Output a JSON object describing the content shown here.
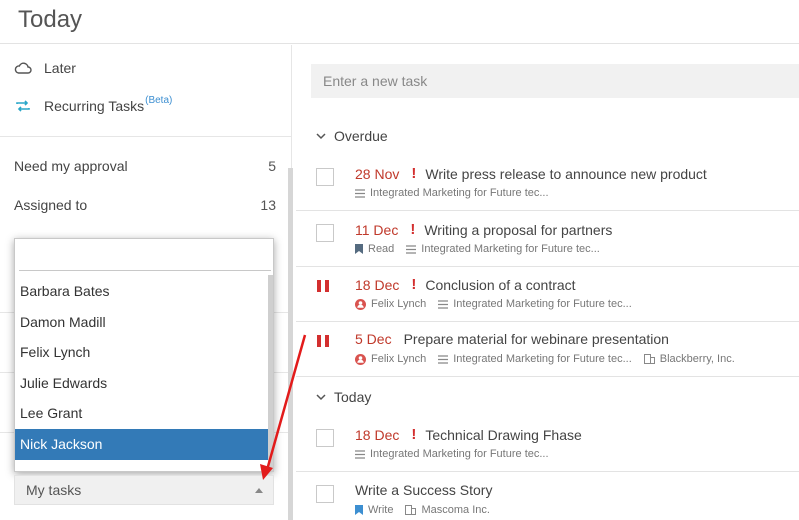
{
  "header": {
    "title": "Today"
  },
  "sidebar": {
    "later_label": "Later",
    "recurring_label": "Recurring Tasks",
    "recurring_badge": "(Beta)",
    "rows": [
      {
        "label": "Need my approval",
        "count": "5"
      },
      {
        "label": "Assigned to",
        "count": "13"
      }
    ],
    "dropdown": {
      "search_value": "",
      "options": [
        "Barbara Bates",
        "Damon Madill",
        "Felix Lynch",
        "Julie Edwards",
        "Lee Grant",
        "Nick Jackson"
      ],
      "selected": "Nick Jackson"
    },
    "filter_select": {
      "value": "My tasks"
    }
  },
  "main": {
    "new_task_placeholder": "Enter a new task",
    "sections": [
      {
        "label": "Overdue"
      },
      {
        "label": "Today"
      }
    ],
    "tasks": [
      {
        "date": "28 Nov",
        "important": true,
        "name": "Write press release to announce new product",
        "meta": [
          {
            "icon": "list-icon",
            "text": "Integrated Marketing for Future tec..."
          }
        ]
      },
      {
        "date": "11 Dec",
        "important": true,
        "name": "Writing a proposal for partners",
        "meta": [
          {
            "icon": "bookmark-icon",
            "text": "Read"
          },
          {
            "icon": "list-icon",
            "text": "Integrated Marketing for Future tec..."
          }
        ]
      },
      {
        "date": "18 Dec",
        "important": true,
        "name": "Conclusion of a contract",
        "meta": [
          {
            "icon": "user-icon",
            "text": "Felix Lynch"
          },
          {
            "icon": "list-icon",
            "text": "Integrated Marketing for Future tec..."
          }
        ]
      },
      {
        "date": "5 Dec",
        "important": false,
        "name": "Prepare material for webinare presentation",
        "meta": [
          {
            "icon": "user-icon",
            "text": "Felix Lynch"
          },
          {
            "icon": "list-icon",
            "text": "Integrated Marketing for Future tec..."
          },
          {
            "icon": "building-icon",
            "text": "Blackberry, Inc."
          }
        ]
      },
      {
        "date": "18 Dec",
        "important": true,
        "name": "Technical Drawing Fhase",
        "meta": [
          {
            "icon": "list-icon",
            "text": "Integrated Marketing for Future tec..."
          }
        ]
      },
      {
        "date": "",
        "important": false,
        "name": "Write a Success Story",
        "meta": [
          {
            "icon": "bookmark-icon",
            "text": "Write"
          },
          {
            "icon": "building-icon",
            "text": "Mascoma Inc."
          }
        ]
      }
    ]
  },
  "colors": {
    "accent": "#337ab7",
    "overdue": "#c0392b",
    "important": "#d32f2f",
    "recurring": "#2aa7c9"
  }
}
